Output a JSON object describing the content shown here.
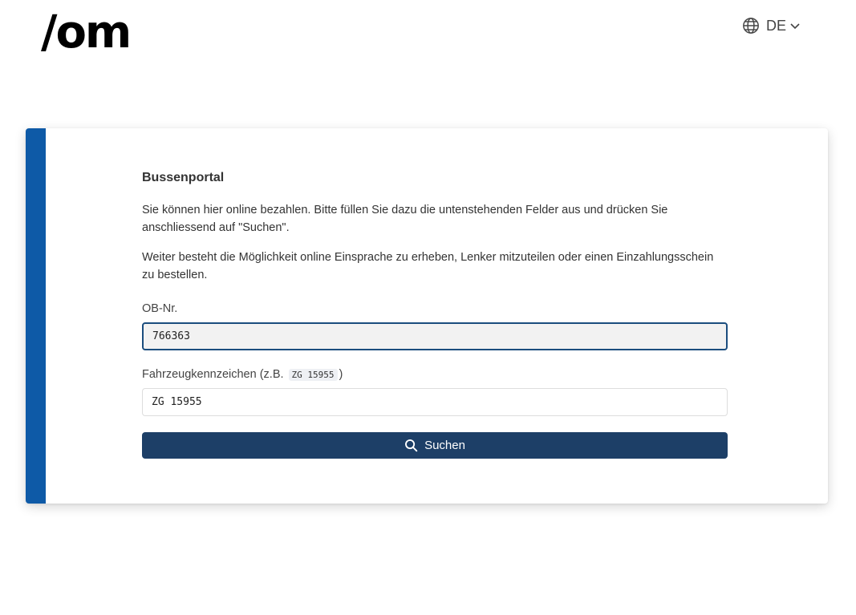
{
  "header": {
    "logo_text": "/om",
    "language": {
      "icon": "globe-icon",
      "current": "DE",
      "dropdown_icon": "chevron-down-icon"
    }
  },
  "form": {
    "accent_color": "#0e5aa7",
    "title": "Bussenportal",
    "paragraphs": [
      "Sie können hier online bezahlen. Bitte füllen Sie dazu die untenstehenden Felder aus und drücken Sie anschliessend auf \"Suchen\".",
      "Weiter besteht die Möglichkeit online Einsprache zu erheben, Lenker mitzuteilen oder einen Einzahlungsschein zu bestellen."
    ],
    "fields": {
      "ob_nr": {
        "label": "OB-Nr.",
        "value": "766363"
      },
      "plate": {
        "label_prefix": "Fahrzeugkennzeichen (z.B.",
        "label_example": "ZG 15955",
        "label_suffix": ")",
        "value": "ZG 15955"
      }
    },
    "submit": {
      "icon": "search-icon",
      "label": "Suchen",
      "color": "#1d3f67"
    }
  }
}
